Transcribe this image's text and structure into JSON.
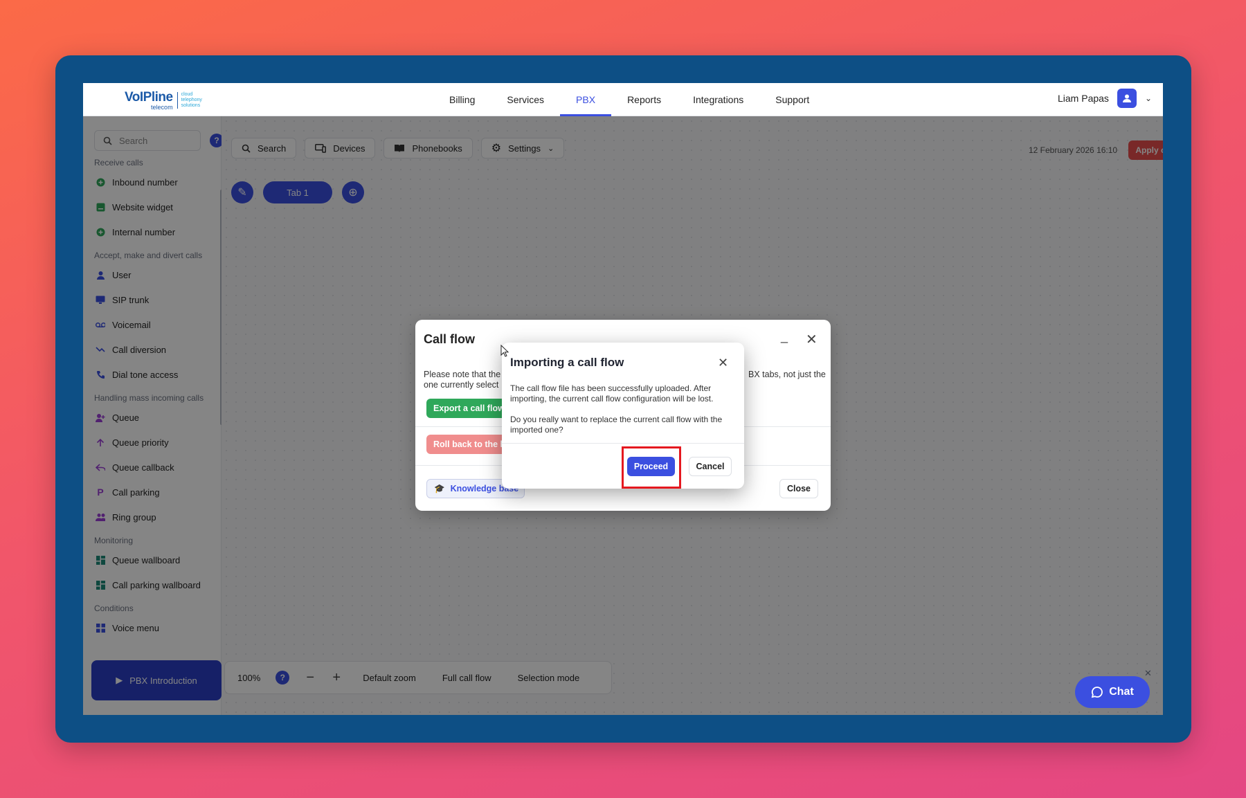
{
  "brand": {
    "name": "VoIPline",
    "sub": "telecom",
    "tagline": "cloud telephony solutions"
  },
  "nav": {
    "items": [
      {
        "label": "Billing"
      },
      {
        "label": "Services"
      },
      {
        "label": "PBX",
        "active": true
      },
      {
        "label": "Reports"
      },
      {
        "label": "Integrations"
      },
      {
        "label": "Support"
      }
    ]
  },
  "user": {
    "name": "Liam Papas"
  },
  "sidebar": {
    "search_placeholder": "Search",
    "help": "?",
    "sections": [
      {
        "title": "Receive calls",
        "items": [
          "Inbound number",
          "Website widget",
          "Internal number"
        ]
      },
      {
        "title": "Accept, make and divert calls",
        "items": [
          "User",
          "SIP trunk",
          "Voicemail",
          "Call diversion",
          "Dial tone access"
        ]
      },
      {
        "title": "Handling mass incoming calls",
        "items": [
          "Queue",
          "Queue priority",
          "Queue callback",
          "Call parking",
          "Ring group"
        ]
      },
      {
        "title": "Monitoring",
        "items": [
          "Queue wallboard",
          "Call parking wallboard"
        ]
      },
      {
        "title": "Conditions",
        "items": [
          "Voice menu"
        ]
      }
    ],
    "intro_button": "PBX Introduction"
  },
  "toolbar": {
    "search": "Search",
    "devices": "Devices",
    "phonebooks": "Phonebooks",
    "settings": "Settings",
    "datetime": "12 February 2026 16:10",
    "apply": "Apply configuration"
  },
  "tabs": {
    "tab1": "Tab 1"
  },
  "zoombar": {
    "zoom": "100%",
    "help": "?",
    "minus": "−",
    "plus": "+",
    "default_zoom": "Default zoom",
    "full_call_flow": "Full call flow",
    "selection_mode": "Selection mode"
  },
  "call_flow_modal": {
    "title": "Call flow",
    "minimize": "_",
    "note_left": "Please note that the",
    "note_right": "BX tabs, not just the",
    "note_line2": "one currently select",
    "export": "Export a call flow",
    "rollback": "Roll back to the la",
    "knowledge_base": "Knowledge base",
    "close": "Close"
  },
  "import_modal": {
    "title": "Importing a call flow",
    "body_1": "The call flow file has been successfully uploaded. After importing, the current call flow configuration will be lost.",
    "body_2": "Do you really want to replace the current call flow with the imported one?",
    "proceed": "Proceed",
    "cancel": "Cancel"
  },
  "chat": {
    "label": "Chat"
  },
  "colors": {
    "accent": "#3b4fe0",
    "highlight": "#e5181f",
    "success": "#2fa85a",
    "danger": "#e84e4e"
  }
}
